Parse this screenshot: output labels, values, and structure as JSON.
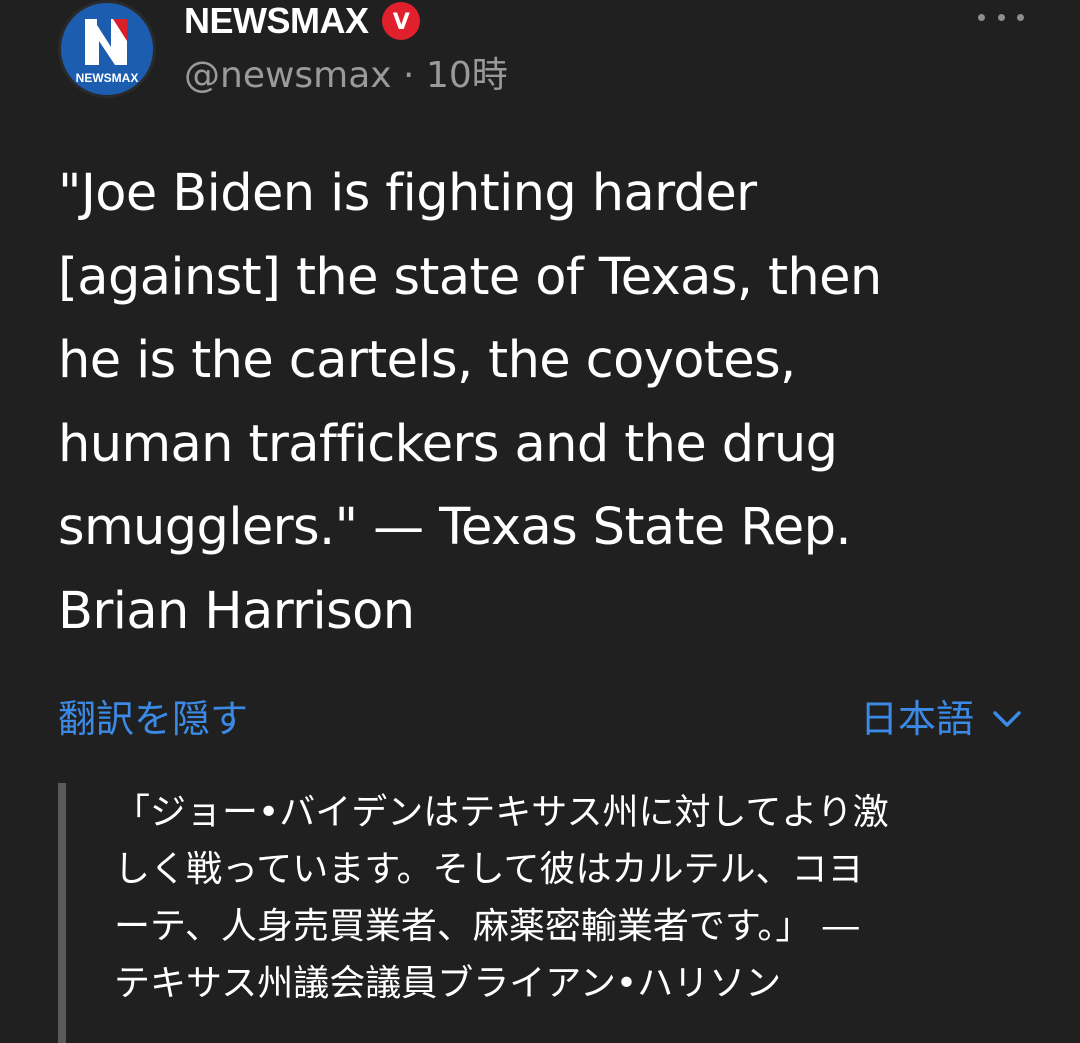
{
  "author": {
    "name": "NEWSMAX",
    "logo_text": "NEWSMAX",
    "logo_letter": "N",
    "verified_badge": "V",
    "handle": "@newsmax",
    "separator": " · ",
    "time": "10時"
  },
  "tweet": {
    "lines": [
      "\"Joe Biden is fighting harder",
      "[against] the state of Texas, then",
      "he is the cartels, the coyotes,",
      "human traffickers and the drug",
      "smugglers.\" — Texas State Rep.",
      "Brian Harrison"
    ]
  },
  "translation": {
    "hide_label": "翻訳を隠す",
    "language": "日本語",
    "lines": [
      "「ジョー•バイデンはテキサス州に対してより激",
      "しく戦っています。そして彼はカルテル、コヨ",
      "ーテ、人身売買業者、麻薬密輸業者です。」 ―",
      "テキサス州議会議員ブライアン•ハリソン"
    ]
  },
  "icons": {
    "more": "more-options-icon",
    "verified": "verified-badge-icon",
    "chevron": "chevron-down-icon"
  },
  "colors": {
    "background": "#202020",
    "link": "#3b8ae6",
    "verified_badge": "#e0202c",
    "brand_blue": "#1a5fb4"
  }
}
